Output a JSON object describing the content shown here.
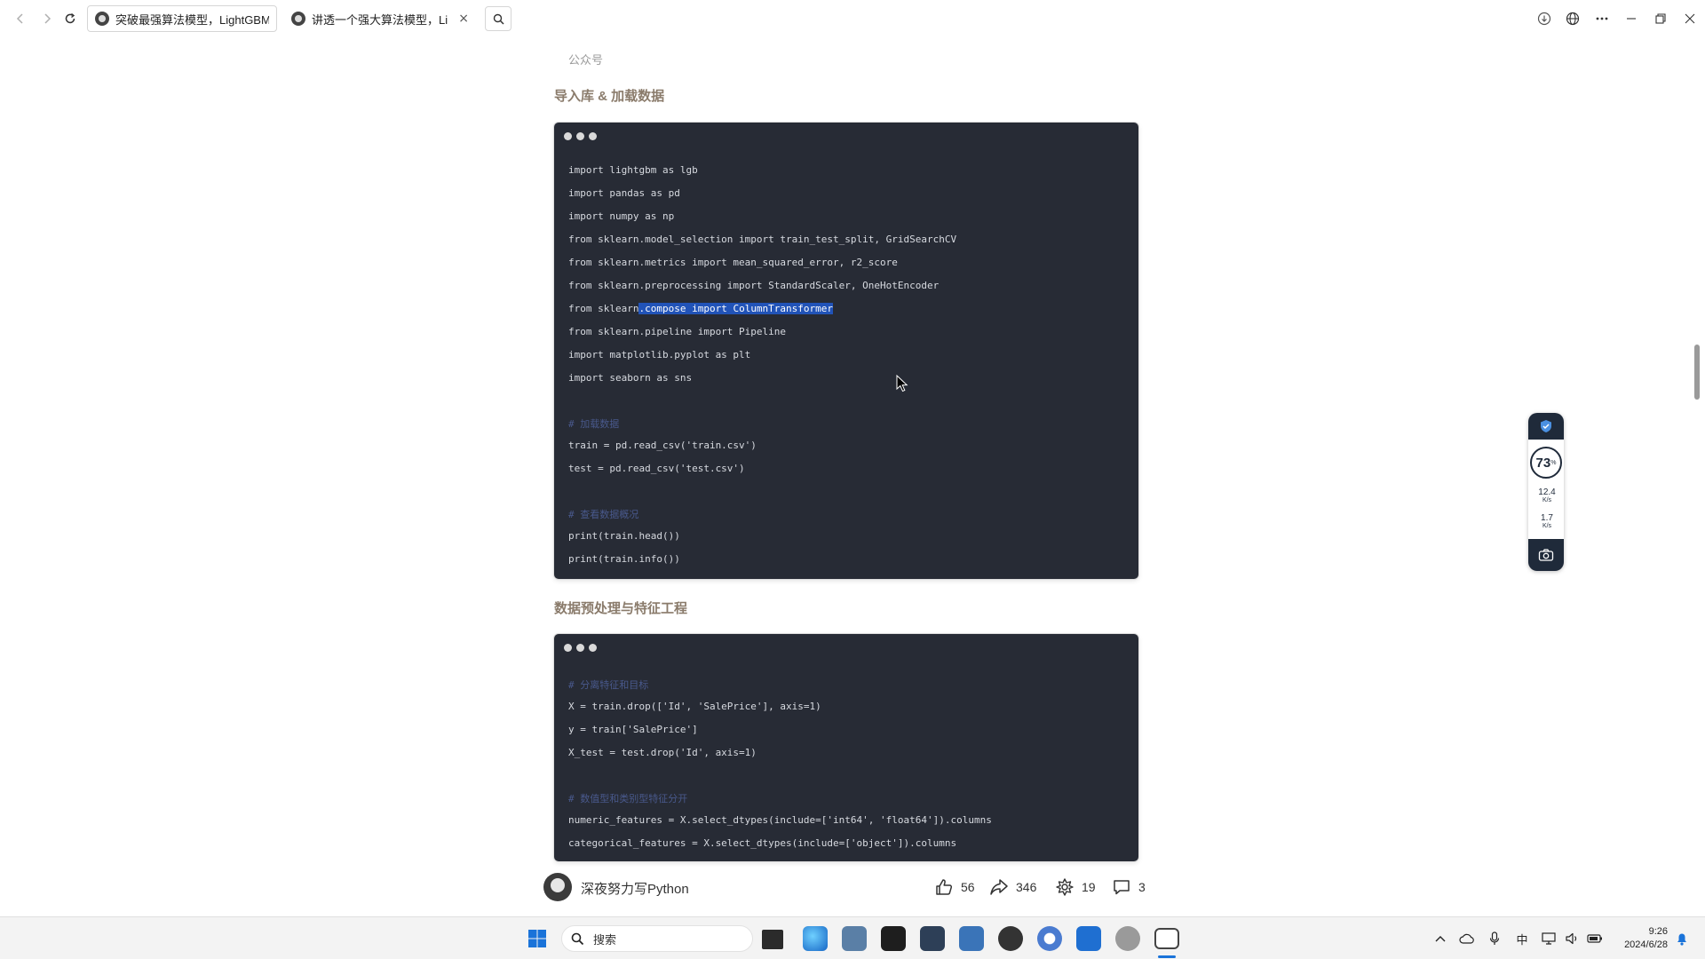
{
  "browser": {
    "tabs": [
      {
        "title": "突破最强算法模型，LightGBM！",
        "active": true
      },
      {
        "title": "讲透一个强大算法模型，LightGBM",
        "active": false
      }
    ],
    "back_icon": "back-arrow-icon",
    "forward_icon": "forward-arrow-icon",
    "reload_icon": "reload-icon",
    "toolbar_icons": [
      "download-icon",
      "globe-icon",
      "more-icon",
      "minimize-icon",
      "restore-icon",
      "close-icon"
    ]
  },
  "article": {
    "source_caption": "公众号",
    "sections": [
      {
        "title": "导入库 & 加载数据",
        "code": [
          {
            "text": "import lightgbm as lgb",
            "type": "code"
          },
          {
            "text": "import pandas as pd",
            "type": "code"
          },
          {
            "text": "import numpy as np",
            "type": "code"
          },
          {
            "text": "from sklearn.model_selection import train_test_split, GridSearchCV",
            "type": "code"
          },
          {
            "text": "from sklearn.metrics import mean_squared_error, r2_score",
            "type": "code"
          },
          {
            "text": "from sklearn.preprocessing import StandardScaler, OneHotEncoder",
            "type": "code"
          },
          {
            "text": "from sklearn.compose import ColumnTransformer",
            "type": "code",
            "selected_from": 12
          },
          {
            "text": "from sklearn.pipeline import Pipeline",
            "type": "code"
          },
          {
            "text": "import matplotlib.pyplot as plt",
            "type": "code"
          },
          {
            "text": "import seaborn as sns",
            "type": "code"
          },
          {
            "text": "# 加载数据",
            "type": "comment"
          },
          {
            "text": "train = pd.read_csv('train.csv')",
            "type": "code"
          },
          {
            "text": "test = pd.read_csv('test.csv')",
            "type": "code"
          },
          {
            "text": "# 查看数据概况",
            "type": "comment"
          },
          {
            "text": "print(train.head())",
            "type": "code"
          },
          {
            "text": "print(train.info())",
            "type": "code"
          }
        ]
      },
      {
        "title": "数据预处理与特征工程",
        "code": [
          {
            "text": "# 分离特征和目标",
            "type": "comment"
          },
          {
            "text": "X = train.drop(['Id', 'SalePrice'], axis=1)",
            "type": "code"
          },
          {
            "text": "y = train['SalePrice']",
            "type": "code"
          },
          {
            "text": "X_test = test.drop('Id', axis=1)",
            "type": "code"
          },
          {
            "text": "# 数值型和类别型特征分开",
            "type": "comment"
          },
          {
            "text": "numeric_features = X.select_dtypes(include=['int64', 'float64']).columns",
            "type": "code"
          },
          {
            "text": "categorical_features = X.select_dtypes(include=['object']).columns",
            "type": "code"
          }
        ]
      }
    ]
  },
  "author_bar": {
    "author": "深夜努力写Python",
    "likes": "56",
    "shares": "346",
    "recommends": "19",
    "comments": "3"
  },
  "monitor_widget": {
    "cpu": "73",
    "cpu_unit": "%",
    "upload": "12.4",
    "upload_unit": "K/s",
    "download": "1.7",
    "download_unit": "K/s"
  },
  "taskbar": {
    "search_placeholder": "搜索",
    "ime": "中",
    "time": "9:26",
    "date": "2024/6/28"
  },
  "colors": {
    "code_bg": "#272b35",
    "selection": "#2153b8",
    "section_title": "#8a7b6b",
    "comment": "#49598c"
  }
}
